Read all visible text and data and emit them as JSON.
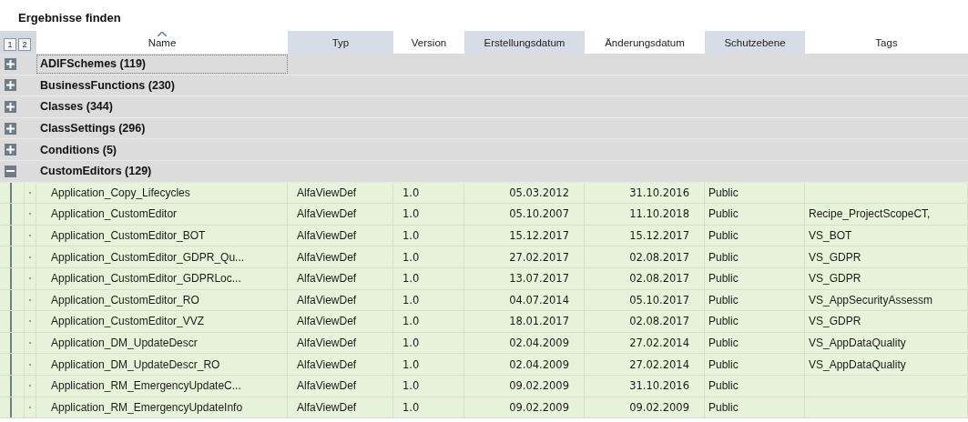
{
  "title": "Ergebnisse finden",
  "outline_levels": [
    "1",
    "2"
  ],
  "columns": [
    {
      "label": "Name",
      "sorted": true,
      "highlighted": false
    },
    {
      "label": "Typ",
      "sorted": false,
      "highlighted": true
    },
    {
      "label": "Version",
      "sorted": false,
      "highlighted": false
    },
    {
      "label": "Erstellungsdatum",
      "sorted": false,
      "highlighted": true
    },
    {
      "label": "Änderungsdatum",
      "sorted": false,
      "highlighted": false
    },
    {
      "label": "Schutzebene",
      "sorted": false,
      "highlighted": true
    },
    {
      "label": "Tags",
      "sorted": false,
      "highlighted": false
    }
  ],
  "groups": [
    {
      "name": "ADIFSchemes (119)",
      "expanded": false,
      "focused": true
    },
    {
      "name": "BusinessFunctions (230)",
      "expanded": false,
      "focused": false
    },
    {
      "name": "Classes (344)",
      "expanded": false,
      "focused": false
    },
    {
      "name": "ClassSettings (296)",
      "expanded": false,
      "focused": false
    },
    {
      "name": "Conditions (5)",
      "expanded": false,
      "focused": false
    },
    {
      "name": "CustomEditors (129)",
      "expanded": true,
      "focused": false,
      "children": [
        {
          "name": "Application_Copy_Lifecycles",
          "type": "AlfaViewDef",
          "version": "1.0",
          "created": "05.03.2012",
          "modified": "31.10.2016",
          "protection": "Public"
        },
        {
          "name": "Application_CustomEditor",
          "type": "AlfaViewDef",
          "version": "1.0",
          "created": "05.10.2007",
          "modified": "11.10.2018",
          "protection": "Public",
          "tags": "Recipe_ProjectScopeCT,"
        },
        {
          "name": "Application_CustomEditor_BOT",
          "type": "AlfaViewDef",
          "version": "1.0",
          "created": "15.12.2017",
          "modified": "15.12.2017",
          "protection": "Public",
          "tags": "VS_BOT"
        },
        {
          "name": "Application_CustomEditor_GDPR_Qu...",
          "type": "AlfaViewDef",
          "version": "1.0",
          "created": "27.02.2017",
          "modified": "02.08.2017",
          "protection": "Public",
          "tags": "VS_GDPR"
        },
        {
          "name": "Application_CustomEditor_GDPRLoc...",
          "type": "AlfaViewDef",
          "version": "1.0",
          "created": "13.07.2017",
          "modified": "02.08.2017",
          "protection": "Public",
          "tags": "VS_GDPR"
        },
        {
          "name": "Application_CustomEditor_RO",
          "type": "AlfaViewDef",
          "version": "1.0",
          "created": "04.07.2014",
          "modified": "05.10.2017",
          "protection": "Public",
          "tags": "VS_AppSecurityAssessm"
        },
        {
          "name": "Application_CustomEditor_VVZ",
          "type": "AlfaViewDef",
          "version": "1.0",
          "created": "18.01.2017",
          "modified": "02.08.2017",
          "protection": "Public",
          "tags": "VS_GDPR"
        },
        {
          "name": "Application_DM_UpdateDescr",
          "type": "AlfaViewDef",
          "version": "1.0",
          "created": "02.04.2009",
          "modified": "27.02.2014",
          "protection": "Public",
          "tags": "VS_AppDataQuality"
        },
        {
          "name": "Application_DM_UpdateDescr_RO",
          "type": "AlfaViewDef",
          "version": "1.0",
          "created": "02.04.2009",
          "modified": "27.02.2014",
          "protection": "Public",
          "tags": "VS_AppDataQuality"
        },
        {
          "name": "Application_RM_EmergencyUpdateC...",
          "type": "AlfaViewDef",
          "version": "1.0",
          "created": "09.02.2009",
          "modified": "31.10.2016",
          "protection": "Public"
        },
        {
          "name": "Application_RM_EmergencyUpdateInfo",
          "type": "AlfaViewDef",
          "version": "1.0",
          "created": "09.02.2009",
          "modified": "09.02.2009",
          "protection": "Public"
        }
      ]
    }
  ]
}
